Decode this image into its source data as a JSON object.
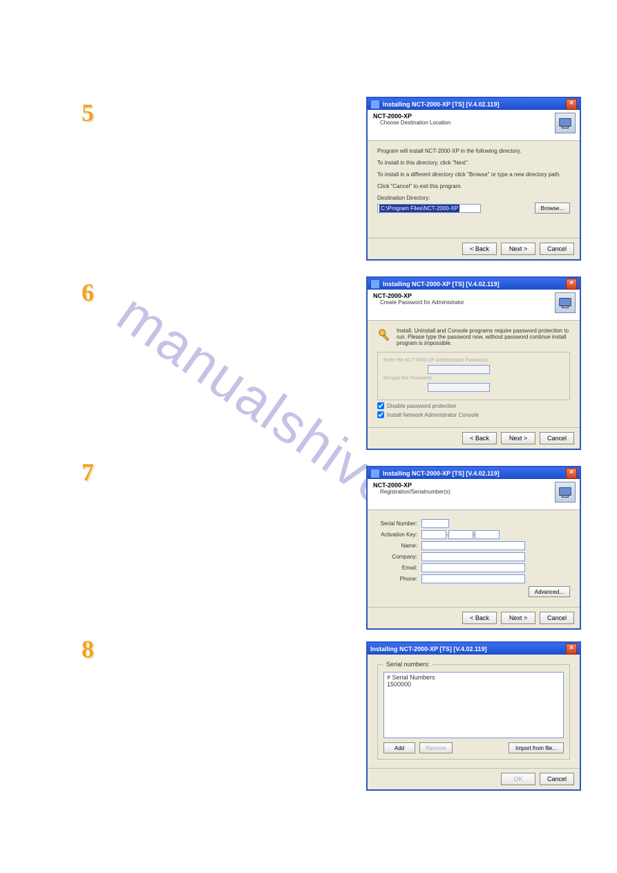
{
  "watermark": "manualshive.com",
  "steps": {
    "s5": "5",
    "s6": "6",
    "s7": "7",
    "s8": "8"
  },
  "d5": {
    "title": "Installing NCT-2000-XP [TS] [V.4.02.119]",
    "productTitle": "NCT-2000-XP",
    "productSub": "Choose Destination Location",
    "p1": "Program will install NCT-2000-XP in the following directory.",
    "p2": "To install in this directory, click \"Next\".",
    "p3": "To install in a different directory click \"Browse\" or type a new directory path.",
    "p4": "Click \"Cancel\" to exit this program.",
    "destLabel": "Destination Directory:",
    "destValue": "C:\\Program Files\\NCT-2000-XP",
    "browse": "Browse...",
    "back": "< Back",
    "next": "Next >",
    "cancel": "Cancel"
  },
  "d6": {
    "title": "Installing NCT-2000-XP [TS] [V.4.02.119]",
    "productTitle": "NCT-2000-XP",
    "productSub": "Create Password for Administrator",
    "info": "Install, Uninstall and Console programs require password protection to run. Please type the password now, without password continue install program is impossible.",
    "pwd1Label": "Enter the NCT-2000-XP Administrator Password:",
    "pwd2Label": "Re-type the Password:",
    "chk1": "Disable password protection",
    "chk2": "Install Network Administrator Console",
    "back": "< Back",
    "next": "Next >",
    "cancel": "Cancel"
  },
  "d7": {
    "title": "Installing NCT-2000-XP [TS] [V.4.02.119]",
    "productTitle": "NCT-2000-XP",
    "productSub": "Registration/Serialnumber(s)",
    "fSerial": "Serial Number:",
    "fActKey": "Activation Key:",
    "fName": "Name:",
    "fCompany": "Company:",
    "fEmail": "Email:",
    "fPhone": "Phone:",
    "advanced": "Advanced...",
    "back": "< Back",
    "next": "Next >",
    "cancel": "Cancel"
  },
  "d8": {
    "title": "Installing NCT-2000-XP [TS] [V.4.02.119]",
    "groupTitle": "Serial numbers:",
    "listHeader": "# Serial Numbers",
    "listItem": "1500000",
    "add": "Add",
    "remove": "Remove",
    "import": "Import from file...",
    "ok": "OK",
    "cancel": "Cancel"
  }
}
